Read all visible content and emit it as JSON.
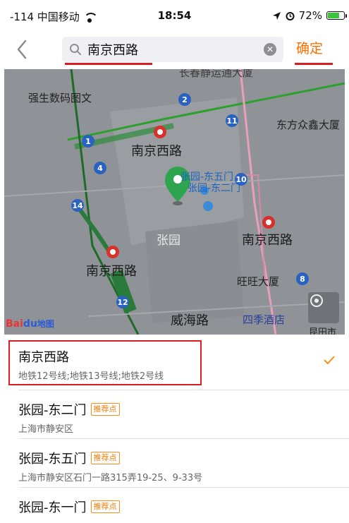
{
  "status_bar": {
    "signal": "-114 中国移动",
    "time": "18:54",
    "battery": "72%",
    "battery_level": 0.72
  },
  "search": {
    "value": "南京西路",
    "confirm_label": "确定"
  },
  "map": {
    "labels": {
      "top_building": "长春静运通大厦",
      "qiangsheng": "强生数码图文",
      "east_plaza": "东方众鑫大厦",
      "station_1": "南京西路",
      "station_2": "南京西路",
      "station_3": "南京西路",
      "marker_label_a": "张园-东五门",
      "marker_label_b": "张园-东二门",
      "zhangyuan": "张园",
      "wangwang": "旺旺大厦",
      "weihai": "威海路",
      "four_seasons": "四季酒店",
      "right_edge": "昆田市"
    },
    "badges": {
      "line_1": "1",
      "line_2": "2",
      "line_4": "4",
      "line_8": "8",
      "line_10": "10",
      "line_11": "11",
      "line_12": "12",
      "line_14": "14"
    },
    "logo_text_a": "Bai",
    "logo_text_b": "du",
    "logo_text_c": "地图"
  },
  "results": [
    {
      "title": "南京西路",
      "subtitle": "地铁12号线;地铁13号线;地铁2号线",
      "selected": true
    },
    {
      "title": "张园-东二门",
      "tag": "推荐点",
      "subtitle": "上海市静安区"
    },
    {
      "title": "张园-东五门",
      "tag": "推荐点",
      "subtitle": "上海市静安区石门一路315弄19-25、9-33号"
    },
    {
      "title": "张园-东一门",
      "tag": "推荐点",
      "subtitle": ""
    }
  ],
  "colors": {
    "accent": "#ff6d00",
    "highlight_box": "#d81e1e",
    "metro_green": "#2ca02c",
    "metro_pink": "#e8a0b8"
  }
}
